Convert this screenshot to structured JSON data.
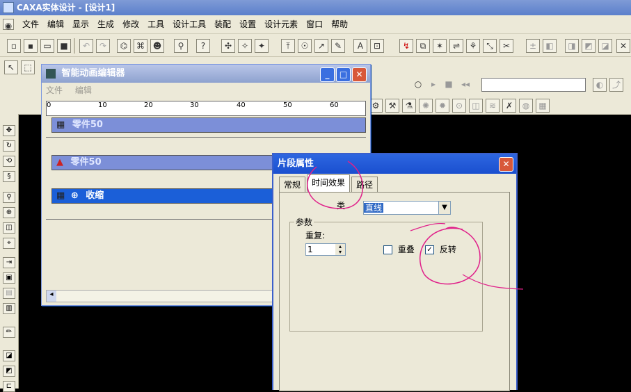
{
  "app": {
    "title": "CAXA实体设计 - [设计1]",
    "menu": [
      "文件",
      "编辑",
      "显示",
      "生成",
      "修改",
      "工具",
      "设计工具",
      "装配",
      "设置",
      "设计元素",
      "窗口",
      "帮助"
    ]
  },
  "anim_editor": {
    "title": "智能动画编辑器",
    "menu": [
      "文件",
      "编辑"
    ],
    "ruler_ticks": [
      "0",
      "10",
      "20",
      "30",
      "40",
      "50",
      "60"
    ],
    "tracks": [
      {
        "label": "零件50",
        "selected": false
      },
      {
        "label": "零件50",
        "selected": false
      },
      {
        "label": "收缩",
        "selected": true
      }
    ]
  },
  "dialog": {
    "title": "片段属性",
    "tabs": [
      "常规",
      "时间效果",
      "路径"
    ],
    "active_tab": "时间效果",
    "class_label": "类",
    "class_value": "直线",
    "params_group": "参数",
    "repeat_label": "重复:",
    "repeat_value": "1",
    "overlap_label": "重叠",
    "overlap_checked": false,
    "reverse_label": "反转",
    "reverse_checked": true
  },
  "colors": {
    "annotation": "#e0208a",
    "titlebar": "#2d66e0",
    "selected_track": "#1b5fd8"
  }
}
